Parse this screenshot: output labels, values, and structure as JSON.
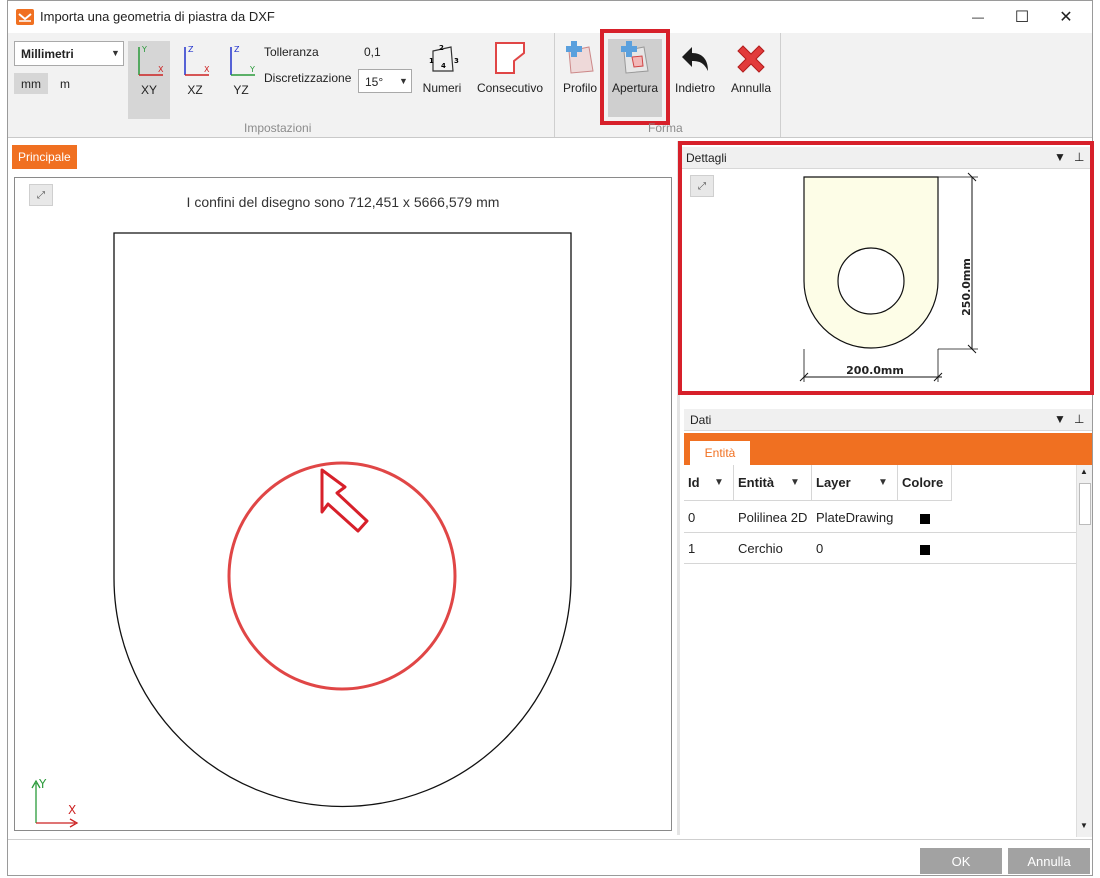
{
  "window": {
    "title": "Importa una geometria di piastra da DXF",
    "minimize_glyph": "—",
    "maximize_glyph": "☐",
    "close_glyph": "✕"
  },
  "ribbon": {
    "units": {
      "selected": "Millimetri",
      "toggle_mm": "mm",
      "toggle_m": "m"
    },
    "planes": [
      {
        "label": "XY",
        "selected": true,
        "axis_v": "Y",
        "axis_h": "X"
      },
      {
        "label": "XZ",
        "selected": false,
        "axis_v": "Z",
        "axis_h": "X"
      },
      {
        "label": "YZ",
        "selected": false,
        "axis_v": "Z",
        "axis_h": "Y"
      }
    ],
    "tolerance_label": "Tolleranza",
    "tolerance_value": "0,1",
    "discretization_label": "Discretizzazione",
    "discretization_value": "15°",
    "numbers_label": "Numeri",
    "consecutive_label": "Consecutivo",
    "settings_group": "Impostazioni",
    "profile_label": "Profilo",
    "opening_label": "Apertura",
    "back_label": "Indietro",
    "cancel_label": "Annulla",
    "shape_group": "Forma",
    "numbers_icon_digits": [
      "1",
      "2",
      "3",
      "4"
    ]
  },
  "main": {
    "tab_label": "Principale",
    "bounds_text": "I confini del disegno sono  712,451 x  5666,579 mm",
    "axis_y": "Y",
    "axis_x": "X"
  },
  "details": {
    "title": "Dettagli",
    "dim_height": "250.0mm",
    "dim_width": "200.0mm"
  },
  "data": {
    "title": "Dati",
    "tab_label": "Entità",
    "columns": [
      "Id",
      "Entità",
      "Layer",
      "Colore"
    ],
    "rows": [
      {
        "id": "0",
        "entity": "Polilinea 2D",
        "layer": "PlateDrawing",
        "color": "#000000"
      },
      {
        "id": "1",
        "entity": "Cerchio",
        "layer": "0",
        "color": "#000000"
      }
    ]
  },
  "footer": {
    "ok_label": "OK",
    "cancel_label": "Annulla"
  },
  "colors": {
    "accent": "#f07021",
    "highlight": "#d7202a",
    "selection_circle": "#e04646",
    "axis_red": "#cc2222",
    "axis_green": "#2a9a3a",
    "axis_blue": "#2233cc"
  }
}
